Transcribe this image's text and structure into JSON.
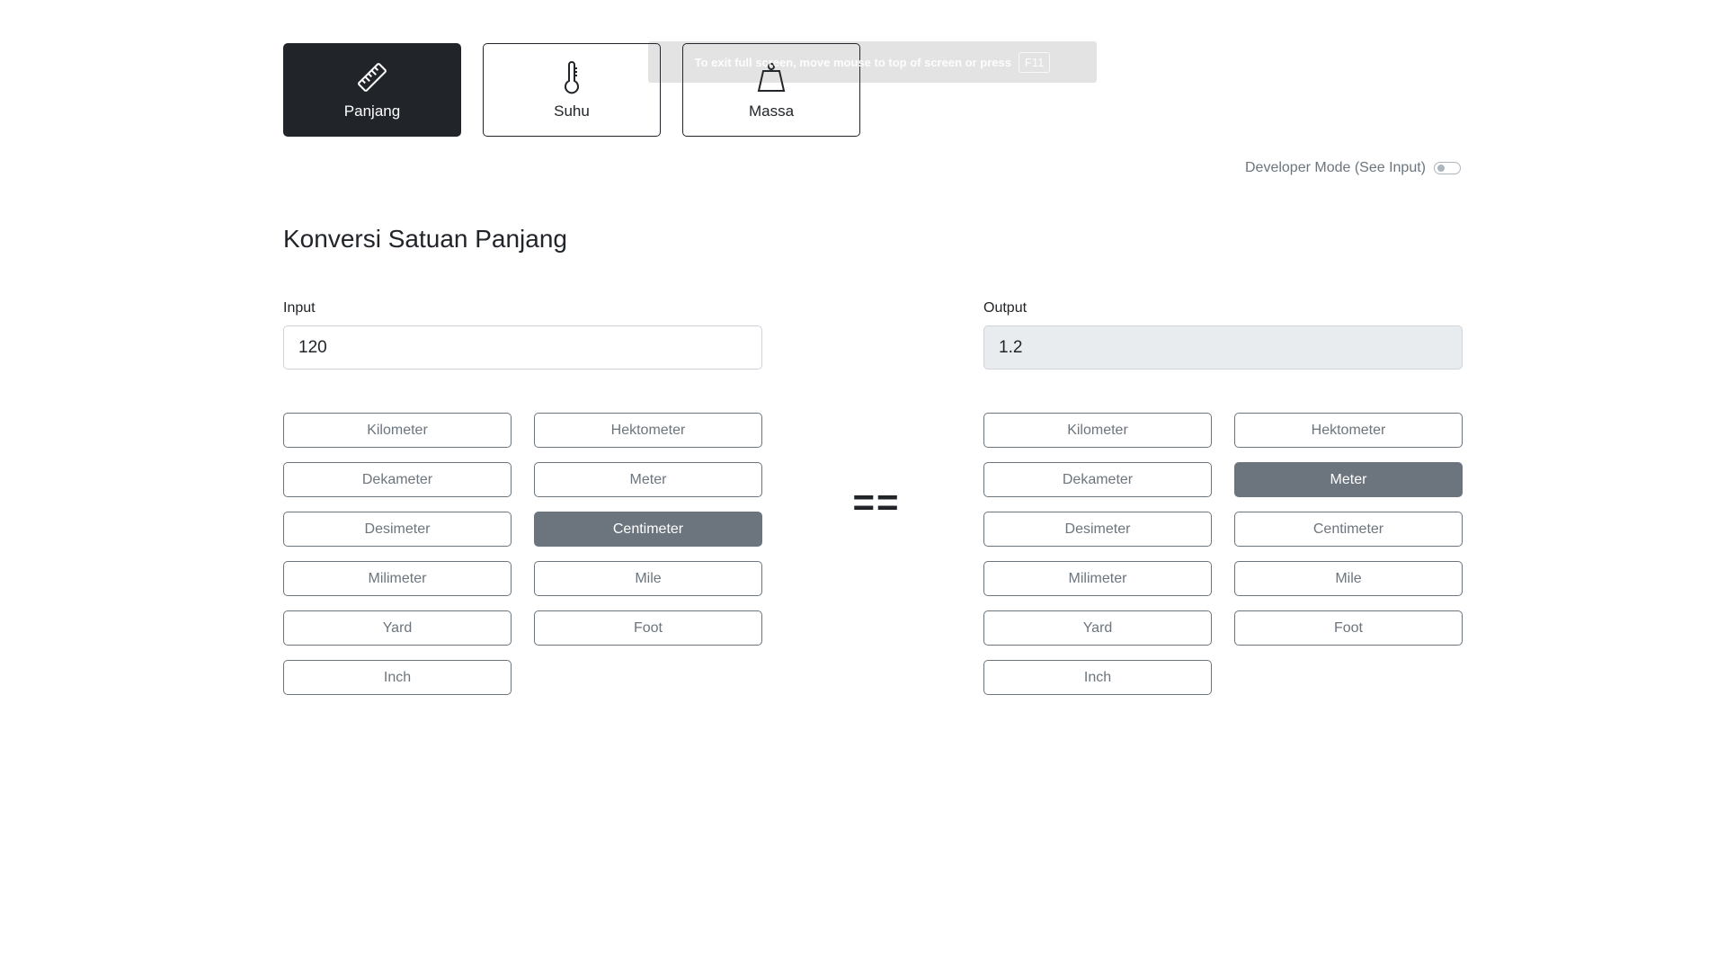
{
  "categories": [
    {
      "label": "Panjang",
      "icon": "ruler-icon",
      "active": true
    },
    {
      "label": "Suhu",
      "icon": "thermometer-icon",
      "active": false
    },
    {
      "label": "Massa",
      "icon": "weight-icon",
      "active": false
    }
  ],
  "fullscreen_toast": {
    "text": "To exit full screen, move mouse to top of screen or press",
    "key": "F11"
  },
  "dev_mode": {
    "label": "Developer Mode (See Input)",
    "enabled": false
  },
  "title": "Konversi Satuan Panjang",
  "input": {
    "label": "Input",
    "value": "120",
    "units": [
      "Kilometer",
      "Hektometer",
      "Dekameter",
      "Meter",
      "Desimeter",
      "Centimeter",
      "Milimeter",
      "Mile",
      "Yard",
      "Foot",
      "Inch"
    ],
    "selected": "Centimeter"
  },
  "equals": "==",
  "output": {
    "label": "Output",
    "value": "1.2",
    "units": [
      "Kilometer",
      "Hektometer",
      "Dekameter",
      "Meter",
      "Desimeter",
      "Centimeter",
      "Milimeter",
      "Mile",
      "Yard",
      "Foot",
      "Inch"
    ],
    "selected": "Meter"
  },
  "colors": {
    "dark": "#212529",
    "secondary": "#6c757d",
    "readonly_bg": "#e9ecef"
  }
}
